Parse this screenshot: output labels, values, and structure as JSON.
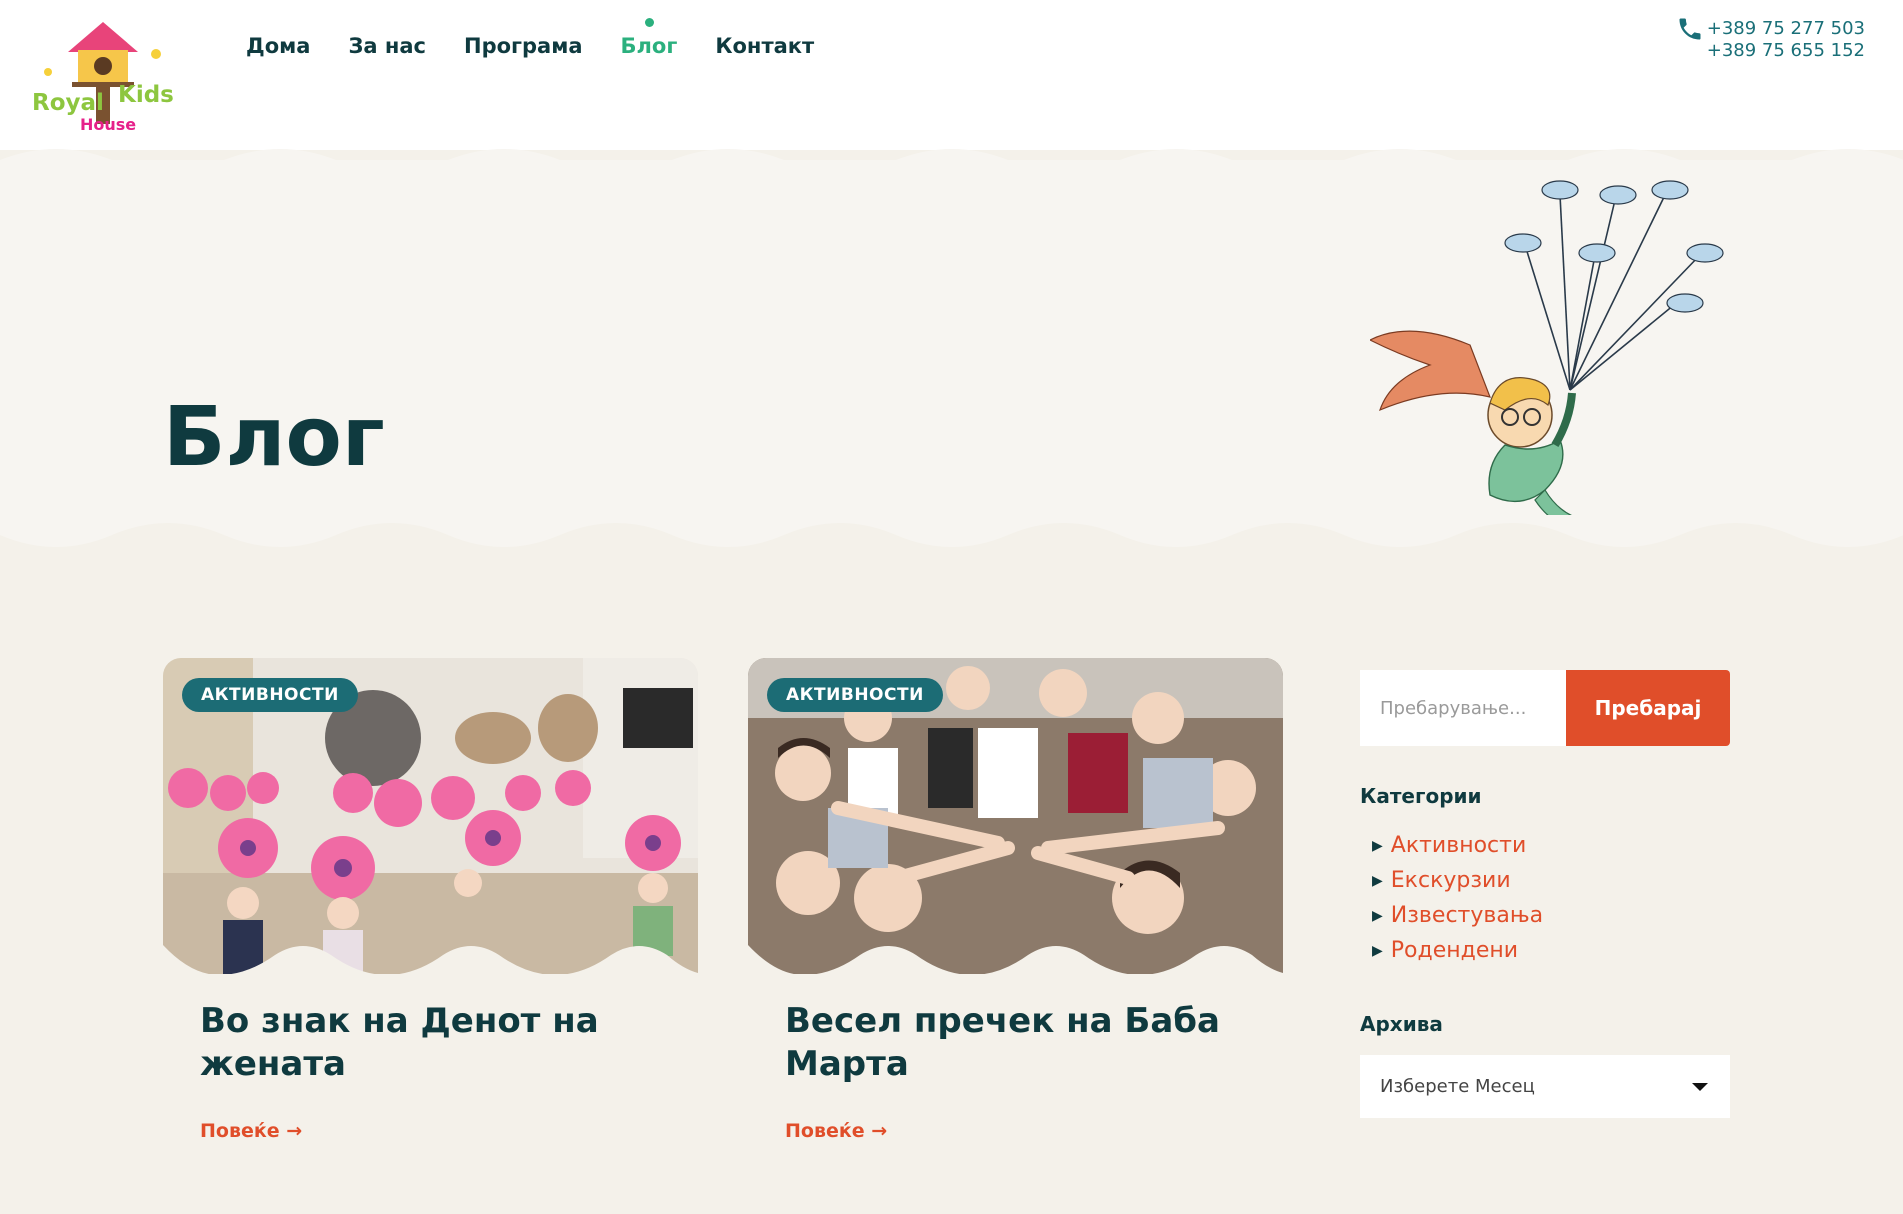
{
  "header": {
    "logo": {
      "line1": "Royal",
      "line2": "Kids",
      "line3": "House"
    },
    "nav": [
      {
        "label": "Дома",
        "active": false
      },
      {
        "label": "За нас",
        "active": false
      },
      {
        "label": "Програма",
        "active": false
      },
      {
        "label": "Блог",
        "active": true
      },
      {
        "label": "Контакт",
        "active": false
      }
    ],
    "phones": [
      "+389 75 277 503",
      "+389 75 655 152"
    ]
  },
  "hero": {
    "title": "Блог"
  },
  "posts": [
    {
      "category": "АКТИВНОСТИ",
      "title": "Во знак на Денот на жената",
      "more": "Повеќе →"
    },
    {
      "category": "АКТИВНОСТИ",
      "title": "Весел пречек на Баба Марта",
      "more": "Повеќе →"
    }
  ],
  "sidebar": {
    "search": {
      "placeholder": "Пребарување...",
      "button": "Пребарај"
    },
    "categories_heading": "Категории",
    "categories": [
      "Активности",
      "Екскурзии",
      "Известувања",
      "Родендени"
    ],
    "archive_heading": "Архива",
    "archive_select": "Изберете Месец"
  },
  "colors": {
    "accent": "#e04e2a",
    "active_nav": "#2bb07e",
    "dark": "#0f3a3f",
    "badge": "#1c6c75"
  }
}
